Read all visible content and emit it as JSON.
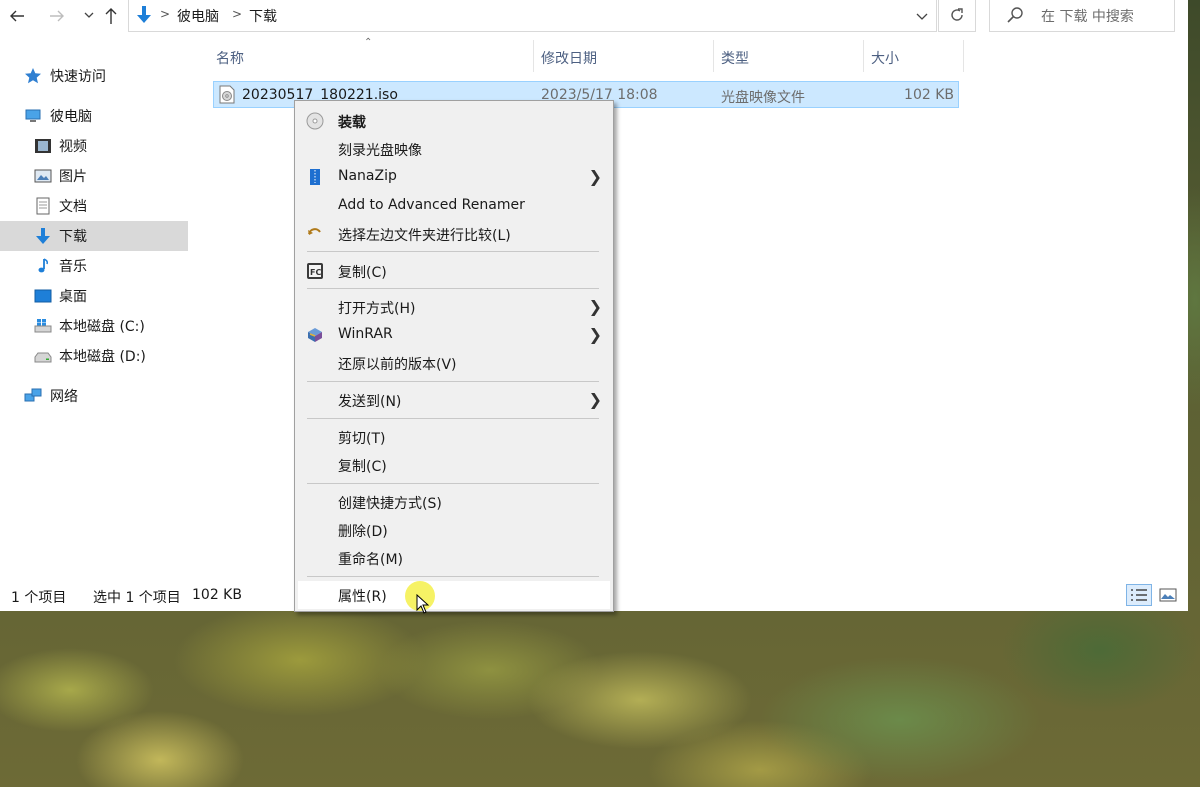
{
  "address": {
    "crumbs": [
      "彼电脑",
      "下载"
    ],
    "search_placeholder": "在 下载 中搜索"
  },
  "sidebar": {
    "items": [
      {
        "label": "快速访问",
        "icon": "star-icon"
      },
      {
        "label": "彼电脑",
        "icon": "computer-icon"
      },
      {
        "label": "视频",
        "icon": "video-icon"
      },
      {
        "label": "图片",
        "icon": "picture-icon"
      },
      {
        "label": "文档",
        "icon": "document-icon"
      },
      {
        "label": "下载",
        "icon": "download-icon"
      },
      {
        "label": "音乐",
        "icon": "music-icon"
      },
      {
        "label": "桌面",
        "icon": "desktop-icon"
      },
      {
        "label": "本地磁盘 (C:)",
        "icon": "windows-drive-icon"
      },
      {
        "label": "本地磁盘 (D:)",
        "icon": "drive-icon"
      },
      {
        "label": "网络",
        "icon": "network-icon"
      }
    ]
  },
  "columns": {
    "name": "名称",
    "modified": "修改日期",
    "type": "类型",
    "size": "大小"
  },
  "files": [
    {
      "name": "20230517_180221.iso",
      "modified": "2023/5/17 18:08",
      "type": "光盘映像文件",
      "size": "102 KB"
    }
  ],
  "status": {
    "count": "1 个项目",
    "selected": "选中 1 个项目",
    "size": "102 KB"
  },
  "context_menu": {
    "items": [
      {
        "label": "装载",
        "icon": "disc-icon",
        "bold": true
      },
      {
        "label": "刻录光盘映像"
      },
      {
        "label": "NanaZip",
        "icon": "nanazip-icon",
        "submenu": true
      },
      {
        "label": "Add to Advanced Renamer"
      },
      {
        "label": "选择左边文件夹进行比较(L)",
        "icon": "compare-icon"
      },
      {
        "label": "复制(C)",
        "icon": "fastcopy-icon"
      },
      {
        "label": "打开方式(H)",
        "submenu": true
      },
      {
        "label": "WinRAR",
        "icon": "winrar-icon",
        "submenu": true
      },
      {
        "label": "还原以前的版本(V)"
      },
      {
        "label": "发送到(N)",
        "submenu": true
      },
      {
        "label": "剪切(T)"
      },
      {
        "label": "复制(C)"
      },
      {
        "label": "创建快捷方式(S)"
      },
      {
        "label": "删除(D)"
      },
      {
        "label": "重命名(M)"
      },
      {
        "label": "属性(R)",
        "hover": true
      }
    ]
  },
  "colors": {
    "selection": "#cce8ff",
    "selection_border": "#99d1ff",
    "menu_bg": "#f0f0f0",
    "header_text": "#4d6082"
  }
}
